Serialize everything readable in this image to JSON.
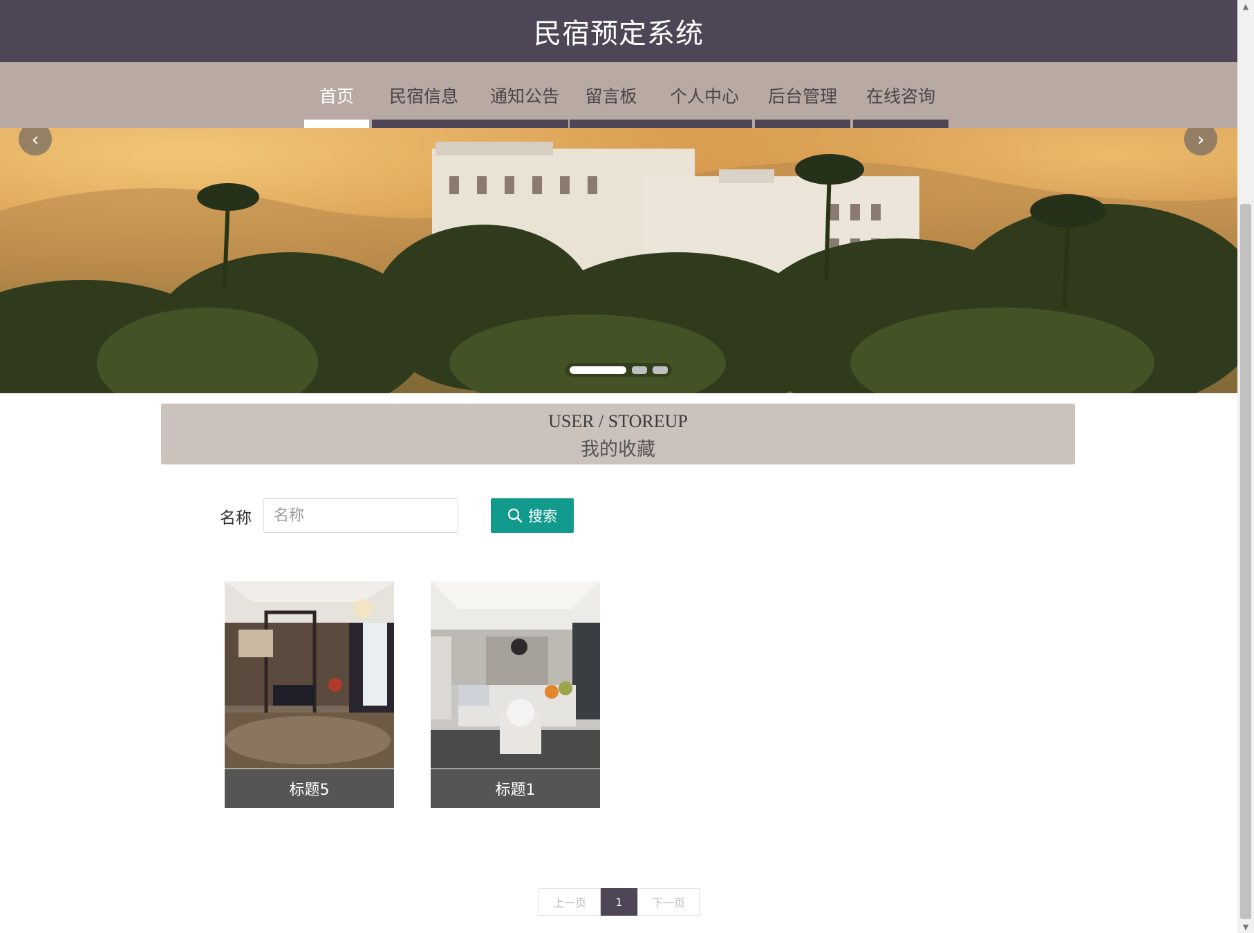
{
  "header": {
    "title": "民宿预定系统"
  },
  "nav": {
    "items": [
      {
        "label": "首页"
      },
      {
        "label": "民宿信息"
      },
      {
        "label": "通知公告"
      },
      {
        "label": "留言板"
      },
      {
        "label": "个人中心"
      },
      {
        "label": "后台管理"
      },
      {
        "label": "在线咨询"
      }
    ],
    "active_index": 0
  },
  "carousel": {
    "prev_icon": "chevron-left-icon",
    "next_icon": "chevron-right-icon",
    "slide_count": 3,
    "active_slide": 1
  },
  "section": {
    "title_en": "USER / STOREUP",
    "title_cn": "我的收藏"
  },
  "search": {
    "label": "名称",
    "placeholder": "名称",
    "value": "",
    "button_label": "搜索",
    "button_icon": "search-icon"
  },
  "cards": [
    {
      "caption": "标题5"
    },
    {
      "caption": "标题1"
    }
  ],
  "pagination": {
    "prev_label": "上一页",
    "current": "1",
    "next_label": "下一页"
  },
  "colors": {
    "header": "#4e4656",
    "nav": "#b8aaa3",
    "section": "#cbc3bb",
    "search_button": "#129a8c",
    "caption": "#555555"
  }
}
